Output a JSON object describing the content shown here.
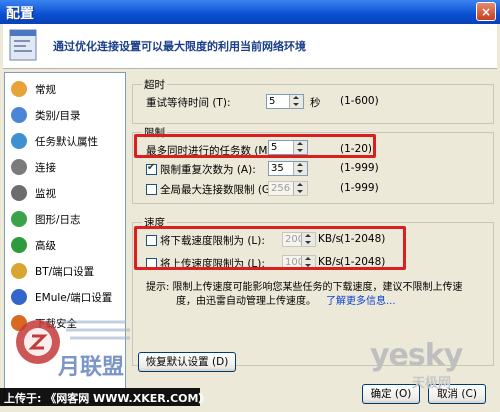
{
  "window": {
    "title": "配置",
    "close_glyph": "×"
  },
  "banner": {
    "text": "通过优化连接设置可以最大限度的利用当前网络环境"
  },
  "sidebar": {
    "items": [
      {
        "label": "常规",
        "icon": "general-icon",
        "color": "#e8a23a"
      },
      {
        "label": "类别/目录",
        "icon": "folder-icon",
        "color": "#4a86d8"
      },
      {
        "label": "任务默认属性",
        "icon": "task-icon",
        "color": "#3f8fd2"
      },
      {
        "label": "连接",
        "icon": "connection-icon",
        "color": "#7b7b7b"
      },
      {
        "label": "监视",
        "icon": "monitor-icon",
        "color": "#6d6d6d"
      },
      {
        "label": "图形/日志",
        "icon": "graph-icon",
        "color": "#3aa34a"
      },
      {
        "label": "高级",
        "icon": "advanced-icon",
        "color": "#2f9a3b"
      },
      {
        "label": "BT/端口设置",
        "icon": "bt-icon",
        "color": "#d8a530"
      },
      {
        "label": "EMule/端口设置",
        "icon": "emule-icon",
        "color": "#3366cc"
      },
      {
        "label": "下载安全",
        "icon": "security-icon",
        "color": "#d86a20"
      }
    ]
  },
  "timeout": {
    "title": "超时",
    "retry_label": "重试等待时间 (T):",
    "retry_value": "5",
    "retry_unit": "秒",
    "retry_range": "(1-600)"
  },
  "limits": {
    "title": "限制",
    "max_tasks_label": "最多同时进行的任务数 (M):",
    "max_tasks_value": "5",
    "max_tasks_range": "(1-20)",
    "retry_count_label": "限制重复次数为 (A):",
    "retry_count_value": "35",
    "retry_count_range": "(1-999)",
    "retry_count_checked": true,
    "max_conn_label": "全局最大连接数限制 (G)",
    "max_conn_value": "256",
    "max_conn_range": "(1-999)",
    "max_conn_checked": false
  },
  "speed": {
    "title": "速度",
    "down_label": "将下载速度限制为 (L):",
    "down_value": "200",
    "down_unit": "KB/s",
    "down_range": "(1-2048)",
    "up_label": "将上传速度限制为 (L):",
    "up_value": "100",
    "up_unit": "KB/s",
    "up_range": "(1-2048)",
    "hint_line1": "提示: 限制上传速度可能影响您某些任务的下载速度，建议不限制上传速",
    "hint_line2": "度，由迅雷自动管理上传速度。",
    "hint_link": "了解更多信息..."
  },
  "buttons": {
    "restore": "恢复默认设置 (D)",
    "ok": "确定 (O)",
    "cancel": "取消 (C)"
  },
  "watermark": {
    "bottom_text": "上传于: 《网客网 WWW.XKER.COM》",
    "logo_text": "月联盟",
    "yesky": "yesky",
    "yesky_cn": "天极网"
  }
}
